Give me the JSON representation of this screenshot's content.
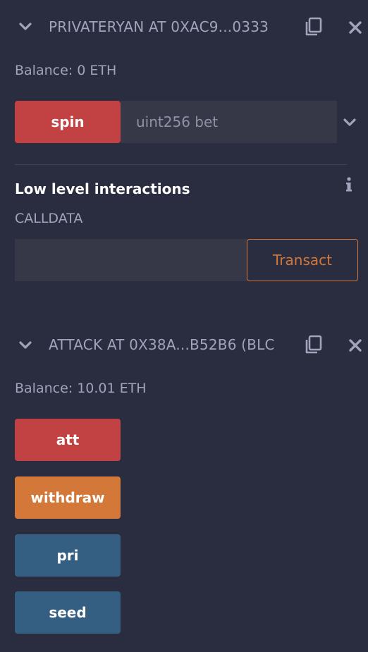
{
  "contracts": [
    {
      "title": "PRIVATERYAN AT 0XAC9...0333",
      "balance": "Balance: 0 ETH",
      "functions": [
        {
          "label": "spin",
          "color": "#c24142",
          "input_placeholder": "uint256 bet"
        }
      ],
      "low_level": {
        "heading": "Low level interactions",
        "calldata_label": "CALLDATA",
        "calldata_value": "",
        "transact_label": "Transact"
      }
    },
    {
      "title": "ATTACK AT 0X38A...B52B6 (BLC",
      "balance": "Balance: 10.01 ETH",
      "functions": [
        {
          "label": "att",
          "color": "#c24142"
        },
        {
          "label": "withdraw",
          "color": "#d4783a"
        },
        {
          "label": "pri",
          "color": "#355f82"
        },
        {
          "label": "seed",
          "color": "#355f82"
        }
      ]
    }
  ],
  "icons": {
    "collapse": "chevron-down-icon",
    "copy": "copy-icon",
    "close": "close-icon",
    "info": "info-icon"
  }
}
